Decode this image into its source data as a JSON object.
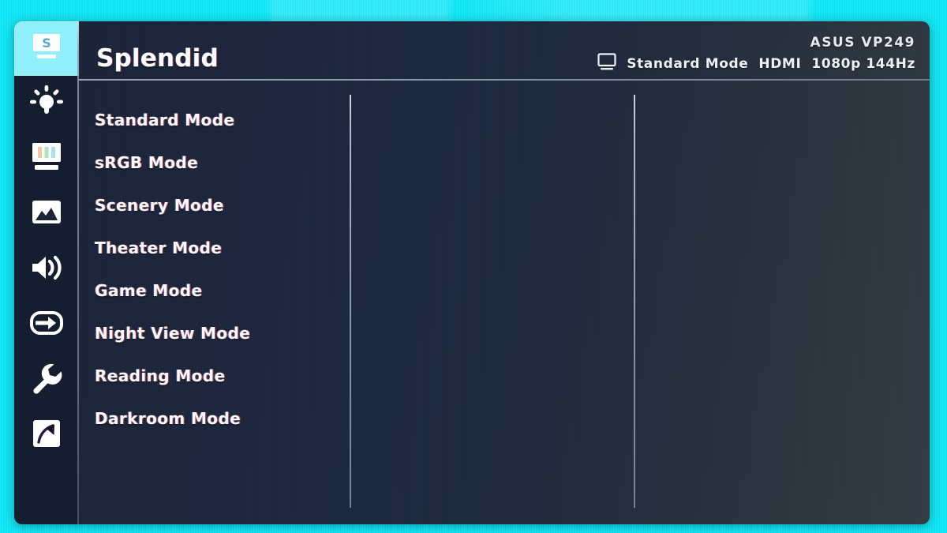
{
  "colors": {
    "desktop_cyan": "#16e4f8",
    "panel_dark": "#1d2740",
    "rail_dark": "#151d30",
    "active_highlight": "#8ff0fb",
    "text_white": "#ffffff",
    "divider": "#b9c6d4"
  },
  "header": {
    "title": "Splendid",
    "model": "ASUS VP249",
    "monitor_icon": "monitor-icon",
    "picture_mode": "Standard Mode",
    "input_source": "HDMI",
    "resolution_refresh": "1080p 144Hz"
  },
  "sidebar": {
    "items": [
      {
        "icon": "splendid-icon",
        "label": "Splendid",
        "active": true
      },
      {
        "icon": "brightness-icon",
        "label": "Blue Light Filter",
        "active": false
      },
      {
        "icon": "color-bars-icon",
        "label": "Color",
        "active": false
      },
      {
        "icon": "image-icon",
        "label": "Image",
        "active": false
      },
      {
        "icon": "speaker-icon",
        "label": "Sound",
        "active": false
      },
      {
        "icon": "input-select-icon",
        "label": "Input Select",
        "active": false
      },
      {
        "icon": "wrench-icon",
        "label": "System Setup",
        "active": false
      },
      {
        "icon": "shortcut-arrow-icon",
        "label": "Shortcut",
        "active": false
      }
    ]
  },
  "main": {
    "menu_items": [
      {
        "label": "Standard Mode"
      },
      {
        "label": "sRGB Mode"
      },
      {
        "label": "Scenery Mode"
      },
      {
        "label": "Theater Mode"
      },
      {
        "label": "Game Mode"
      },
      {
        "label": "Night View Mode"
      },
      {
        "label": "Reading Mode"
      },
      {
        "label": "Darkroom Mode"
      }
    ]
  }
}
